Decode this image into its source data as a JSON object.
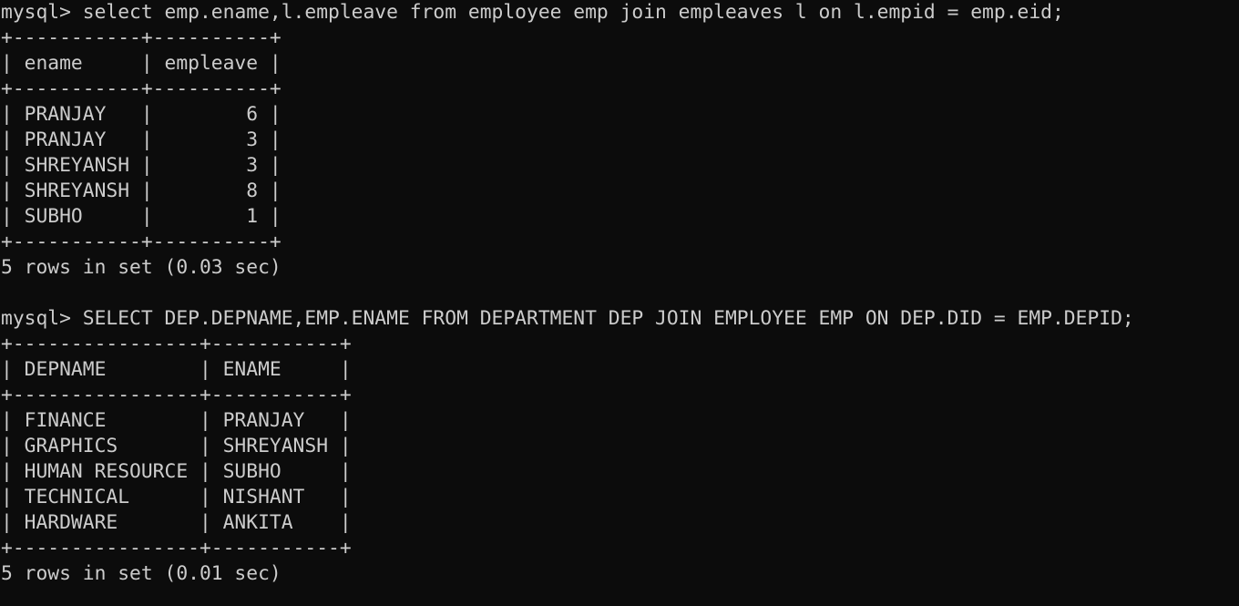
{
  "terminal": {
    "prompt": "mysql>",
    "queries": [
      {
        "command": "select emp.ename,l.empleave from employee emp join empleaves l on l.empid = emp.eid;",
        "border": "+-----------+----------+",
        "header": "| ename     | empleave |",
        "rows": [
          "| PRANJAY   |        6 |",
          "| PRANJAY   |        3 |",
          "| SHREYANSH |        3 |",
          "| SHREYANSH |        8 |",
          "| SUBHO     |        1 |"
        ],
        "status": "5 rows in set (0.03 sec)"
      },
      {
        "command": "SELECT DEP.DEPNAME,EMP.ENAME FROM DEPARTMENT DEP JOIN EMPLOYEE EMP ON DEP.DID = EMP.DEPID;",
        "border": "+----------------+-----------+",
        "header": "| DEPNAME        | ENAME     |",
        "rows": [
          "| FINANCE        | PRANJAY   |",
          "| GRAPHICS       | SHREYANSH |",
          "| HUMAN RESOURCE | SUBHO     |",
          "| TECHNICAL      | NISHANT   |",
          "| HARDWARE       | ANKITA    |"
        ],
        "status": "5 rows in set (0.01 sec)"
      }
    ]
  }
}
